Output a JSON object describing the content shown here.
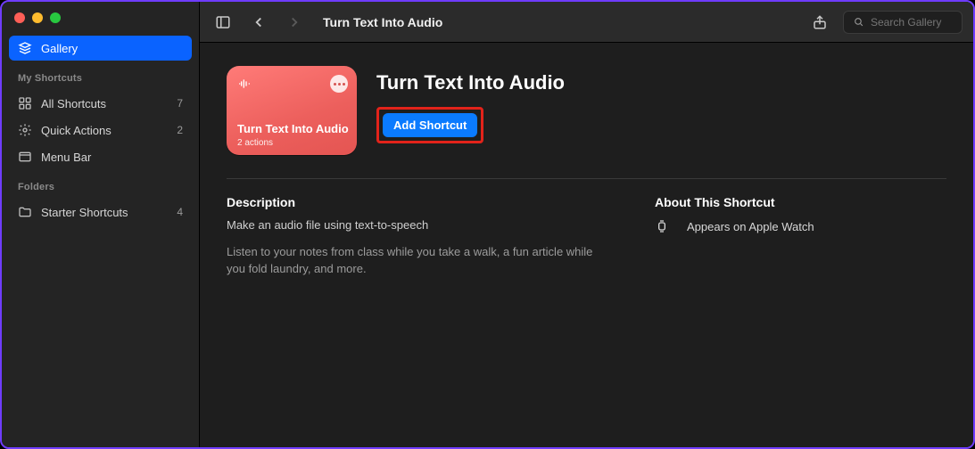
{
  "sidebar": {
    "top_item": {
      "label": "Gallery"
    },
    "section1_label": "My Shortcuts",
    "items": [
      {
        "label": "All Shortcuts",
        "count": "7"
      },
      {
        "label": "Quick Actions",
        "count": "2"
      },
      {
        "label": "Menu Bar"
      }
    ],
    "section2_label": "Folders",
    "folders": [
      {
        "label": "Starter Shortcuts",
        "count": "4"
      }
    ]
  },
  "toolbar": {
    "title": "Turn Text Into Audio",
    "search_placeholder": "Search Gallery"
  },
  "hero": {
    "card_title": "Turn Text Into Audio",
    "card_sub": "2 actions",
    "page_title": "Turn Text Into Audio",
    "add_label": "Add Shortcut"
  },
  "desc": {
    "heading": "Description",
    "lede": "Make an audio file using text-to-speech",
    "body": "Listen to your notes from class while you take a walk, a fun article while you fold laundry, and more."
  },
  "about": {
    "heading": "About This Shortcut",
    "feature1": "Appears on Apple Watch"
  }
}
